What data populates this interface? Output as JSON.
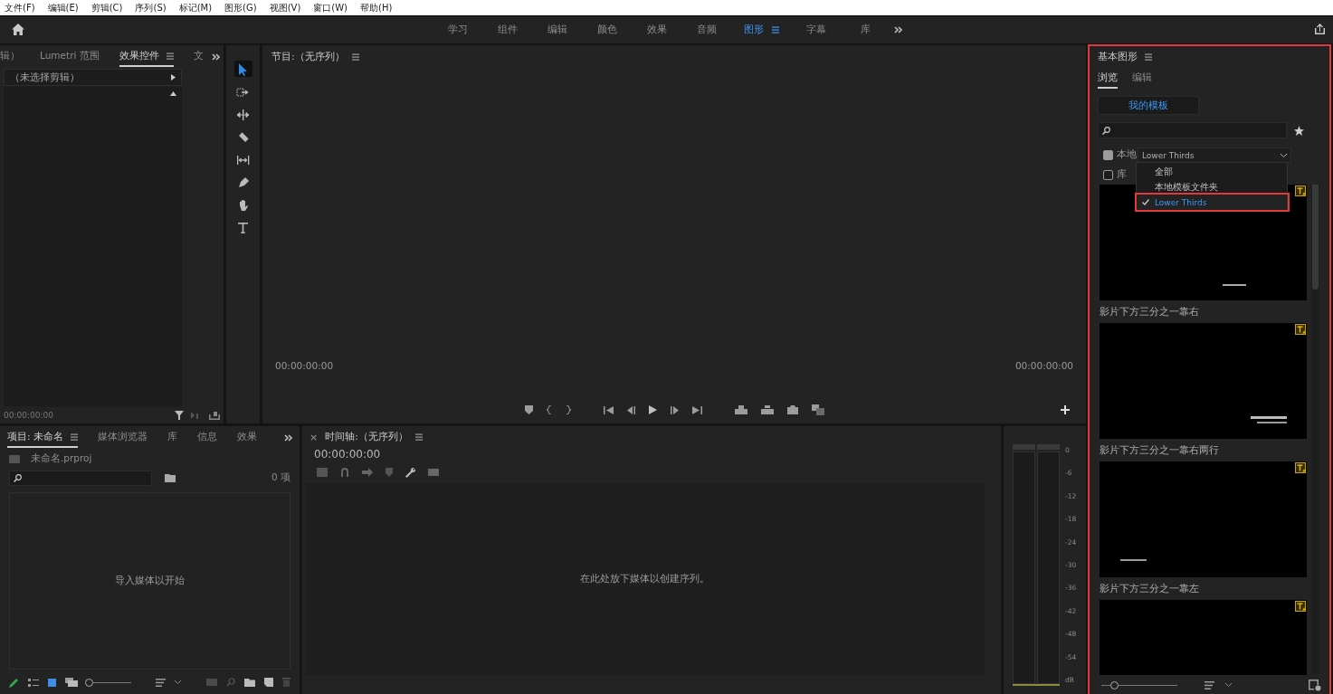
{
  "menu_bar": {
    "items": [
      "文件(F)",
      "编辑(E)",
      "剪辑(C)",
      "序列(S)",
      "标记(M)",
      "图形(G)",
      "视图(V)",
      "窗口(W)",
      "帮助(H)"
    ]
  },
  "workspace_bar": {
    "tabs": [
      {
        "label": "学习",
        "selected": false
      },
      {
        "label": "组件",
        "selected": false
      },
      {
        "label": "编辑",
        "selected": false
      },
      {
        "label": "颜色",
        "selected": false
      },
      {
        "label": "效果",
        "selected": false
      },
      {
        "label": "音频",
        "selected": false
      },
      {
        "label": "图形",
        "selected": true
      },
      {
        "label": "字幕",
        "selected": false
      },
      {
        "label": "库",
        "selected": false
      }
    ]
  },
  "effects_panel": {
    "tabs": [
      {
        "label": "辑）",
        "selected": false
      },
      {
        "label": "Lumetri 范围",
        "selected": false
      },
      {
        "label": "效果控件",
        "selected": true
      },
      {
        "label": "文",
        "selected": false
      }
    ],
    "clip_header": "（未选择剪辑）",
    "timecode": "00:00:00:00"
  },
  "tools": [
    {
      "kind": "selection",
      "selected": true
    },
    {
      "kind": "track-select",
      "selected": false
    },
    {
      "kind": "ripple",
      "selected": false
    },
    {
      "kind": "razor",
      "selected": false
    },
    {
      "kind": "slip",
      "selected": false
    },
    {
      "kind": "pen",
      "selected": false
    },
    {
      "kind": "hand",
      "selected": false
    },
    {
      "kind": "type",
      "selected": false
    }
  ],
  "program_monitor": {
    "title": "节目:（无序列）",
    "timecode_left": "00:00:00:00",
    "timecode_right": "00:00:00:00"
  },
  "project_panel": {
    "tabs": [
      {
        "label": "项目: 未命名",
        "selected": true
      },
      {
        "label": "媒体浏览器",
        "selected": false
      },
      {
        "label": "库",
        "selected": false
      },
      {
        "label": "信息",
        "selected": false
      },
      {
        "label": "效果",
        "selected": false
      }
    ],
    "file_name": "未命名.prproj",
    "item_count": "0 项",
    "empty_message": "导入媒体以开始",
    "zoom_slider": {
      "level": 0.05
    }
  },
  "timeline": {
    "close": "×",
    "title": "时间轴:（无序列）",
    "timecode": "00:00:00:00",
    "empty_message": "在此处放下媒体以创建序列。"
  },
  "audio_meter": {
    "scale": [
      "0",
      "-6",
      "-12",
      "-18",
      "-24",
      "-30",
      "-36",
      "-42",
      "-48",
      "-54",
      "dB"
    ]
  },
  "essential_graphics": {
    "title": "基本图形",
    "tabs": [
      {
        "label": "浏览",
        "selected": true
      },
      {
        "label": "编辑",
        "selected": false
      }
    ],
    "my_templates": "我的模板",
    "filters": [
      {
        "label": "本地",
        "checked": true
      },
      {
        "label": "库",
        "checked": false
      }
    ],
    "dropdown": {
      "value": "Lower Thirds",
      "options": [
        {
          "label": "全部",
          "selected": false
        },
        {
          "label": "本地模板文件夹",
          "selected": false
        },
        {
          "label": "Lower Thirds",
          "selected": true
        }
      ]
    },
    "templates": [
      {
        "kind": "right",
        "name": "影片下方三分之一靠右"
      },
      {
        "kind": "right_two_lines",
        "name": "影片下方三分之一靠右两行"
      },
      {
        "kind": "left",
        "name": "影片下方三分之一靠左"
      },
      {
        "kind": "blank"
      }
    ],
    "size_slider": {
      "level": 0.17
    }
  }
}
